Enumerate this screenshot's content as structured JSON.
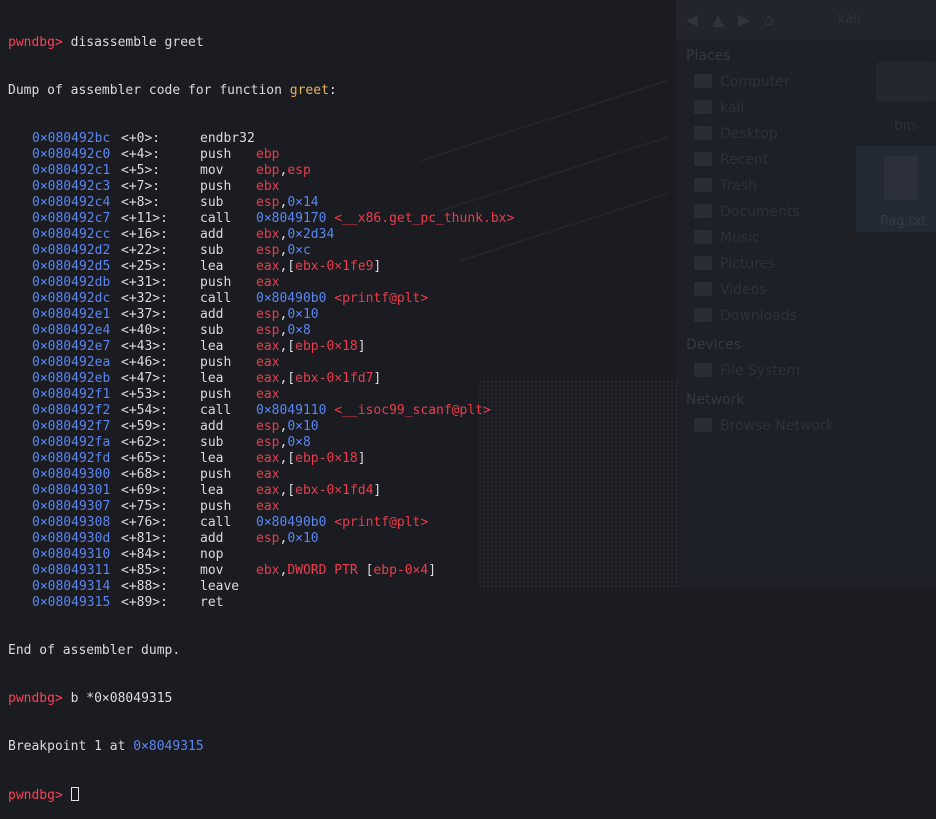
{
  "colors": {
    "background": "#1a1c21",
    "prompt": "#ff3f55",
    "address": "#5a86f0",
    "register": "#ee3a4a",
    "function_name": "#e6b450",
    "text": "#d8dadf"
  },
  "terminal": {
    "prompt": "pwndbg>",
    "command1": "disassemble greet",
    "dump_header_prefix": "Dump of assembler code for function ",
    "dump_header_func": "greet",
    "dump_header_suffix": ":",
    "instructions": [
      {
        "addr": "0×080492bc",
        "off": "<+0>:",
        "mn": "endbr32",
        "ops": []
      },
      {
        "addr": "0×080492c0",
        "off": "<+4>:",
        "mn": "push",
        "ops": [
          {
            "t": "reg",
            "v": "ebp"
          }
        ]
      },
      {
        "addr": "0×080492c1",
        "off": "<+5>:",
        "mn": "mov",
        "ops": [
          {
            "t": "reg",
            "v": "ebp"
          },
          {
            "t": "plain",
            "v": ","
          },
          {
            "t": "reg",
            "v": "esp"
          }
        ]
      },
      {
        "addr": "0×080492c3",
        "off": "<+7>:",
        "mn": "push",
        "ops": [
          {
            "t": "reg",
            "v": "ebx"
          }
        ]
      },
      {
        "addr": "0×080492c4",
        "off": "<+8>:",
        "mn": "sub",
        "ops": [
          {
            "t": "reg",
            "v": "esp"
          },
          {
            "t": "plain",
            "v": ","
          },
          {
            "t": "num",
            "v": "0×14"
          }
        ]
      },
      {
        "addr": "0×080492c7",
        "off": "<+11>:",
        "mn": "call",
        "ops": [
          {
            "t": "num",
            "v": "0×8049170"
          },
          {
            "t": "plain",
            "v": " "
          },
          {
            "t": "sym",
            "v": "<__x86.get_pc_thunk.bx>"
          }
        ]
      },
      {
        "addr": "0×080492cc",
        "off": "<+16>:",
        "mn": "add",
        "ops": [
          {
            "t": "reg",
            "v": "ebx"
          },
          {
            "t": "plain",
            "v": ","
          },
          {
            "t": "num",
            "v": "0×2d34"
          }
        ]
      },
      {
        "addr": "0×080492d2",
        "off": "<+22>:",
        "mn": "sub",
        "ops": [
          {
            "t": "reg",
            "v": "esp"
          },
          {
            "t": "plain",
            "v": ","
          },
          {
            "t": "num",
            "v": "0×c"
          }
        ]
      },
      {
        "addr": "0×080492d5",
        "off": "<+25>:",
        "mn": "lea",
        "ops": [
          {
            "t": "reg",
            "v": "eax"
          },
          {
            "t": "plain",
            "v": ",["
          },
          {
            "t": "reg",
            "v": "ebx-0×1fe9"
          },
          {
            "t": "plain",
            "v": "]"
          }
        ]
      },
      {
        "addr": "0×080492db",
        "off": "<+31>:",
        "mn": "push",
        "ops": [
          {
            "t": "reg",
            "v": "eax"
          }
        ]
      },
      {
        "addr": "0×080492dc",
        "off": "<+32>:",
        "mn": "call",
        "ops": [
          {
            "t": "num",
            "v": "0×80490b0"
          },
          {
            "t": "plain",
            "v": " "
          },
          {
            "t": "sym",
            "v": "<printf@plt>"
          }
        ]
      },
      {
        "addr": "0×080492e1",
        "off": "<+37>:",
        "mn": "add",
        "ops": [
          {
            "t": "reg",
            "v": "esp"
          },
          {
            "t": "plain",
            "v": ","
          },
          {
            "t": "num",
            "v": "0×10"
          }
        ]
      },
      {
        "addr": "0×080492e4",
        "off": "<+40>:",
        "mn": "sub",
        "ops": [
          {
            "t": "reg",
            "v": "esp"
          },
          {
            "t": "plain",
            "v": ","
          },
          {
            "t": "num",
            "v": "0×8"
          }
        ]
      },
      {
        "addr": "0×080492e7",
        "off": "<+43>:",
        "mn": "lea",
        "ops": [
          {
            "t": "reg",
            "v": "eax"
          },
          {
            "t": "plain",
            "v": ",["
          },
          {
            "t": "reg",
            "v": "ebp-0×18"
          },
          {
            "t": "plain",
            "v": "]"
          }
        ]
      },
      {
        "addr": "0×080492ea",
        "off": "<+46>:",
        "mn": "push",
        "ops": [
          {
            "t": "reg",
            "v": "eax"
          }
        ]
      },
      {
        "addr": "0×080492eb",
        "off": "<+47>:",
        "mn": "lea",
        "ops": [
          {
            "t": "reg",
            "v": "eax"
          },
          {
            "t": "plain",
            "v": ",["
          },
          {
            "t": "reg",
            "v": "ebx-0×1fd7"
          },
          {
            "t": "plain",
            "v": "]"
          }
        ]
      },
      {
        "addr": "0×080492f1",
        "off": "<+53>:",
        "mn": "push",
        "ops": [
          {
            "t": "reg",
            "v": "eax"
          }
        ]
      },
      {
        "addr": "0×080492f2",
        "off": "<+54>:",
        "mn": "call",
        "ops": [
          {
            "t": "num",
            "v": "0×8049110"
          },
          {
            "t": "plain",
            "v": " "
          },
          {
            "t": "sym",
            "v": "<__isoc99_scanf@plt>"
          }
        ]
      },
      {
        "addr": "0×080492f7",
        "off": "<+59>:",
        "mn": "add",
        "ops": [
          {
            "t": "reg",
            "v": "esp"
          },
          {
            "t": "plain",
            "v": ","
          },
          {
            "t": "num",
            "v": "0×10"
          }
        ]
      },
      {
        "addr": "0×080492fa",
        "off": "<+62>:",
        "mn": "sub",
        "ops": [
          {
            "t": "reg",
            "v": "esp"
          },
          {
            "t": "plain",
            "v": ","
          },
          {
            "t": "num",
            "v": "0×8"
          }
        ]
      },
      {
        "addr": "0×080492fd",
        "off": "<+65>:",
        "mn": "lea",
        "ops": [
          {
            "t": "reg",
            "v": "eax"
          },
          {
            "t": "plain",
            "v": ",["
          },
          {
            "t": "reg",
            "v": "ebp-0×18"
          },
          {
            "t": "plain",
            "v": "]"
          }
        ]
      },
      {
        "addr": "0×08049300",
        "off": "<+68>:",
        "mn": "push",
        "ops": [
          {
            "t": "reg",
            "v": "eax"
          }
        ]
      },
      {
        "addr": "0×08049301",
        "off": "<+69>:",
        "mn": "lea",
        "ops": [
          {
            "t": "reg",
            "v": "eax"
          },
          {
            "t": "plain",
            "v": ",["
          },
          {
            "t": "reg",
            "v": "ebx-0×1fd4"
          },
          {
            "t": "plain",
            "v": "]"
          }
        ]
      },
      {
        "addr": "0×08049307",
        "off": "<+75>:",
        "mn": "push",
        "ops": [
          {
            "t": "reg",
            "v": "eax"
          }
        ]
      },
      {
        "addr": "0×08049308",
        "off": "<+76>:",
        "mn": "call",
        "ops": [
          {
            "t": "num",
            "v": "0×80490b0"
          },
          {
            "t": "plain",
            "v": " "
          },
          {
            "t": "sym",
            "v": "<printf@plt>"
          }
        ]
      },
      {
        "addr": "0×0804930d",
        "off": "<+81>:",
        "mn": "add",
        "ops": [
          {
            "t": "reg",
            "v": "esp"
          },
          {
            "t": "plain",
            "v": ","
          },
          {
            "t": "num",
            "v": "0×10"
          }
        ]
      },
      {
        "addr": "0×08049310",
        "off": "<+84>:",
        "mn": "nop",
        "ops": []
      },
      {
        "addr": "0×08049311",
        "off": "<+85>:",
        "mn": "mov",
        "ops": [
          {
            "t": "reg",
            "v": "ebx"
          },
          {
            "t": "plain",
            "v": ","
          },
          {
            "t": "reg",
            "v": "DWORD PTR"
          },
          {
            "t": "plain",
            "v": " ["
          },
          {
            "t": "reg",
            "v": "ebp-0×4"
          },
          {
            "t": "plain",
            "v": "]"
          }
        ]
      },
      {
        "addr": "0×08049314",
        "off": "<+88>:",
        "mn": "leave",
        "ops": []
      },
      {
        "addr": "0×08049315",
        "off": "<+89>:",
        "mn": "ret",
        "ops": []
      }
    ],
    "dump_footer": "End of assembler dump.",
    "command2": "b *0×08049315",
    "breakpoint_prefix": "Breakpoint 1 at ",
    "breakpoint_addr": "0×8049315"
  },
  "background_file_manager": {
    "location": "kali",
    "sections": {
      "places": "Places",
      "devices": "Devices",
      "network": "Network"
    },
    "places_items": [
      {
        "icon": "computer-icon",
        "label": "Computer"
      },
      {
        "icon": "home-icon",
        "label": "kali"
      },
      {
        "icon": "desktop-icon",
        "label": "Desktop"
      },
      {
        "icon": "recent-icon",
        "label": "Recent"
      },
      {
        "icon": "trash-icon",
        "label": "Trash"
      },
      {
        "icon": "documents-icon",
        "label": "Documents"
      },
      {
        "icon": "music-icon",
        "label": "Music"
      },
      {
        "icon": "pictures-icon",
        "label": "Pictures"
      },
      {
        "icon": "videos-icon",
        "label": "Videos"
      },
      {
        "icon": "downloads-icon",
        "label": "Downloads"
      }
    ],
    "devices_items": [
      {
        "icon": "drive-icon",
        "label": "File System"
      }
    ],
    "network_items": [
      {
        "icon": "network-icon",
        "label": "Browse Network"
      }
    ],
    "folder_label": "bin",
    "selected_file_label": "flag.txt"
  }
}
